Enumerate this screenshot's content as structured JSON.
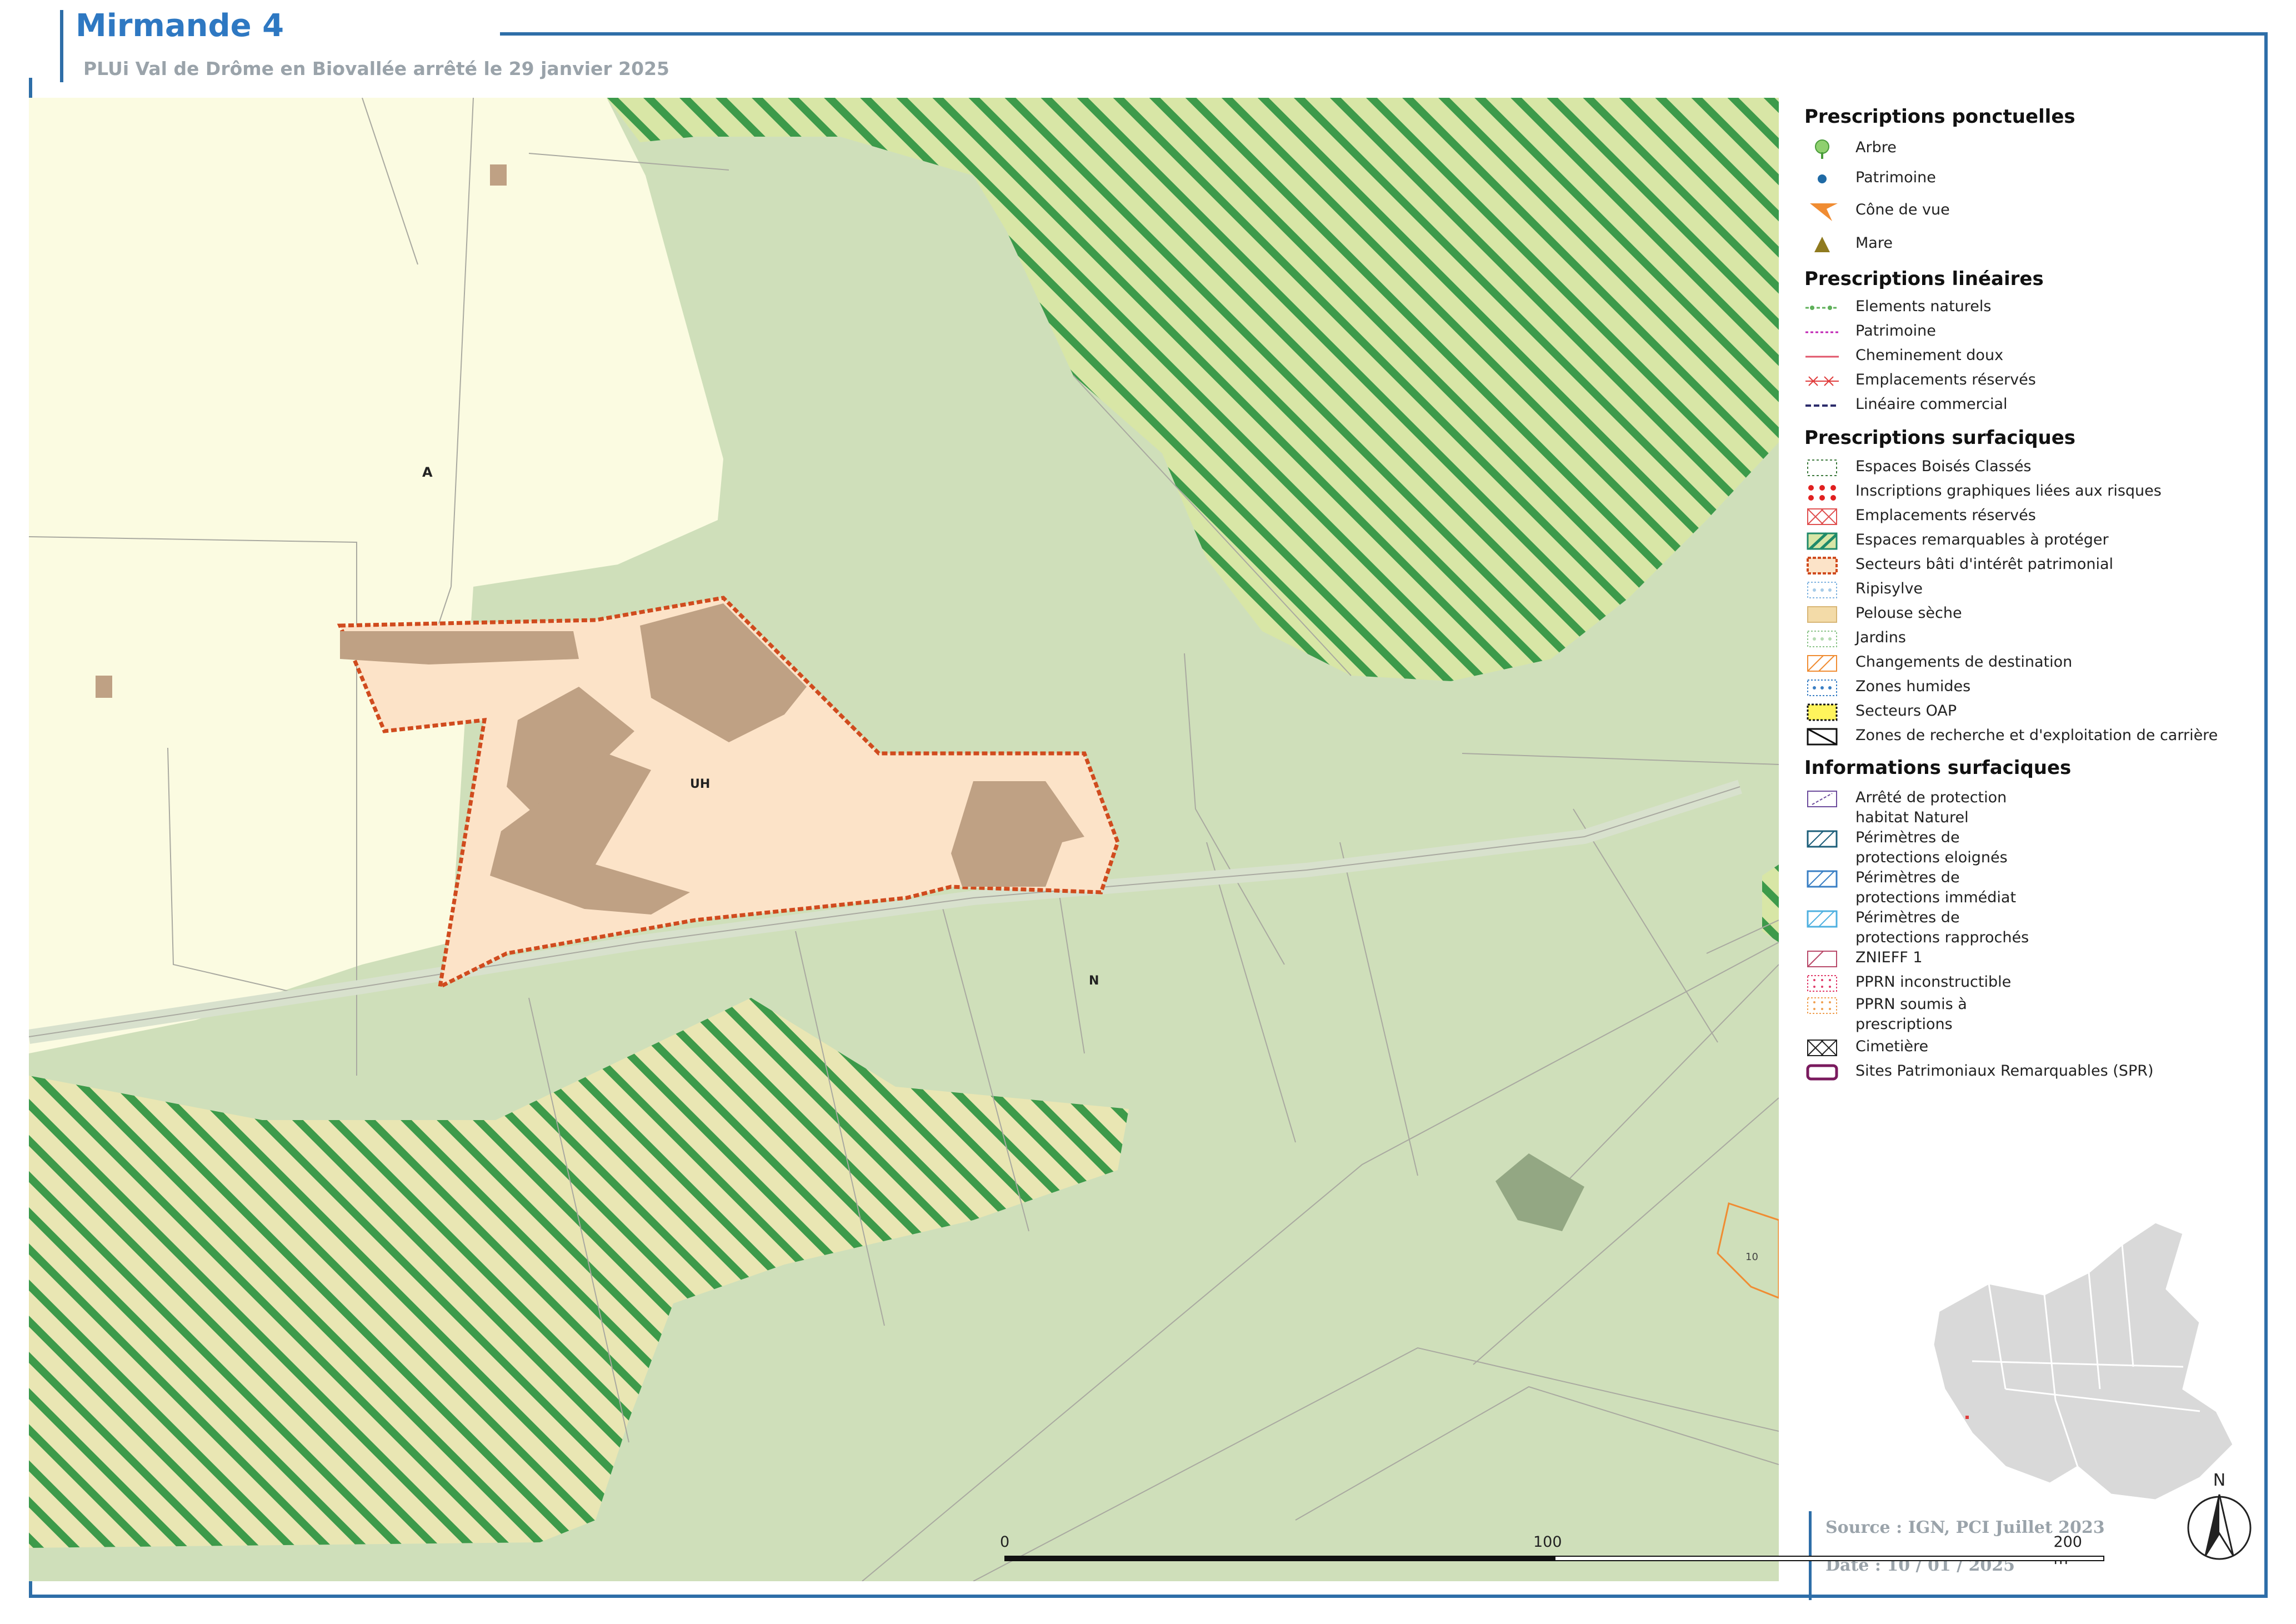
{
  "header": {
    "title": "Mirmande 4",
    "subtitle": "PLUi Val de Drôme en Biovallée arrêté le 29 janvier 2025"
  },
  "map_labels": {
    "zone_a": "A",
    "zone_uh": "UH",
    "zone_n": "N",
    "change_dest_number": "10"
  },
  "legend": {
    "ponctuelles": {
      "heading": "Prescriptions ponctuelles",
      "items": [
        "Arbre",
        "Patrimoine",
        "Cône de vue",
        "Mare"
      ]
    },
    "lineaires": {
      "heading": "Prescriptions linéaires",
      "items": [
        "Elements naturels",
        "Patrimoine",
        "Cheminement doux",
        "Emplacements réservés",
        "Linéaire commercial"
      ]
    },
    "surfaciques": {
      "heading": "Prescriptions surfaciques",
      "items": [
        "Espaces Boisés Classés",
        "Inscriptions graphiques liées aux risques",
        "Emplacements réservés",
        "Espaces remarquables à protéger",
        "Secteurs bâti d'intérêt patrimonial",
        "Ripisylve",
        "Pelouse sèche",
        "Jardins",
        "Changements de destination",
        "Zones humides",
        "Secteurs OAP",
        "Zones de recherche et d'exploitation de carrière"
      ]
    },
    "informations": {
      "heading": "Informations surfaciques",
      "items": [
        "Arrêté de protection",
        "habitat Naturel",
        "Périmètres de",
        "protections eloignés",
        "Périmètres de",
        "protections immédiat",
        "Périmètres de",
        "protections rapprochés",
        "ZNIEFF 1",
        "PPRN inconstructible",
        "PPRN soumis à",
        "prescriptions",
        "Cimetière",
        "Sites Patrimoniaux Remarquables (SPR)"
      ]
    }
  },
  "scale": {
    "start": "0",
    "mid": "100",
    "end": "200 m"
  },
  "footer": {
    "source": "Source : IGN, PCI Juillet 2023",
    "date": "Date : 10 / 01 / 2025"
  },
  "north_label": "N",
  "colors": {
    "frame": "#2e6ea8",
    "zone_a": "#fbfbe1",
    "zone_n": "#cfdfba",
    "zone_uh": "#fce3c8",
    "building": "#bfa184",
    "hatch_green": "#3d9a4a",
    "patrimonial_border": "#d04b1e"
  }
}
